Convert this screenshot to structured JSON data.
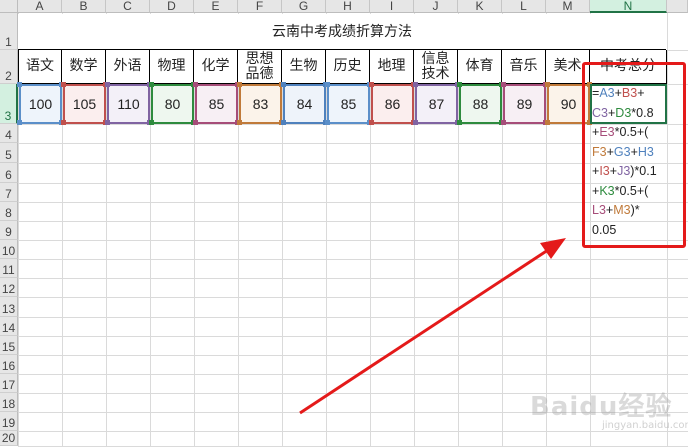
{
  "columns": [
    "A",
    "B",
    "C",
    "D",
    "E",
    "F",
    "G",
    "H",
    "I",
    "J",
    "K",
    "L",
    "M",
    "N"
  ],
  "rows": [
    "1",
    "2",
    "3",
    "4",
    "5",
    "6",
    "7",
    "8",
    "9",
    "10",
    "11",
    "12",
    "13",
    "14",
    "15",
    "16",
    "17",
    "18",
    "19",
    "20"
  ],
  "selected_column": "N",
  "selected_row": "3",
  "title": "云南中考成绩折算方法",
  "headers": [
    "语文",
    "数学",
    "外语",
    "物理",
    "化学",
    "思想\n品德",
    "生物",
    "历史",
    "地理",
    "信息\n技术",
    "体育",
    "音乐",
    "美术",
    "中考总分"
  ],
  "values": [
    "100",
    "105",
    "110",
    "80",
    "85",
    "83",
    "84",
    "85",
    "86",
    "87",
    "88",
    "89",
    "90"
  ],
  "cell_colors": [
    "#5b8fc9",
    "#c0504d",
    "#8064a2",
    "#2e8b3e",
    "#a64d79",
    "#c07a3a",
    "#4f81bd",
    "#5b8fc9",
    "#c0504d",
    "#8064a2",
    "#2e8b3e",
    "#a64d79",
    "#c07a3a"
  ],
  "cell_fills": [
    "#eef4fb",
    "#fbeeee",
    "#f3f0f8",
    "#eef7ef",
    "#f7eff4",
    "#fbf3ea",
    "#eef3fa",
    "#eef4fb",
    "#fbeeee",
    "#f3f0f8",
    "#eef7ef",
    "#f7eff4",
    "#fbf3ea"
  ],
  "formula_lines": [
    [
      [
        "=",
        ""
      ],
      [
        "A3",
        "#4f81bd"
      ],
      [
        "+",
        ""
      ],
      [
        "B3",
        "#c0504d"
      ],
      [
        "+",
        ""
      ]
    ],
    [
      [
        "C3",
        "#8064a2"
      ],
      [
        "+",
        ""
      ],
      [
        "D3",
        "#2e8b3e"
      ],
      [
        "*0.8",
        ""
      ]
    ],
    [
      [
        "+",
        ""
      ],
      [
        "E3",
        "#a64d79"
      ],
      [
        "*0.5+(",
        ""
      ]
    ],
    [
      [
        "F3",
        "#c07a3a"
      ],
      [
        "+",
        ""
      ],
      [
        "G3",
        "#4f81bd"
      ],
      [
        "+",
        ""
      ],
      [
        "H3",
        "#4f81bd"
      ]
    ],
    [
      [
        "+",
        ""
      ],
      [
        "I3",
        "#c0504d"
      ],
      [
        "+",
        ""
      ],
      [
        "J3",
        "#8064a2"
      ],
      [
        ")*0.1",
        ""
      ]
    ],
    [
      [
        "+",
        ""
      ],
      [
        "K3",
        "#2e8b3e"
      ],
      [
        "*0.5+(",
        ""
      ]
    ],
    [
      [
        "L3",
        "#a64d79"
      ],
      [
        "+",
        ""
      ],
      [
        "M3",
        "#c07a3a"
      ],
      [
        ")*",
        ""
      ]
    ],
    [
      [
        "0.05",
        ""
      ]
    ]
  ],
  "watermark": "Baidu经验",
  "watermark_sub": "jingyan.baidu.com",
  "colors": {
    "accent": "#217346",
    "annotation": "#e41a1a"
  }
}
